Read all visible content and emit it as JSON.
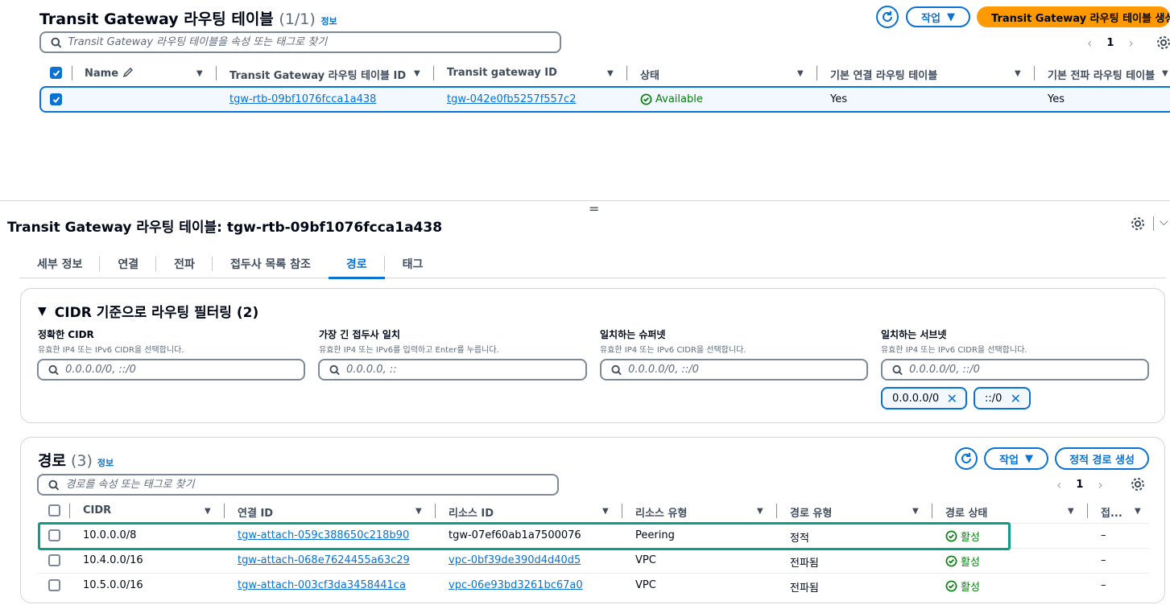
{
  "top": {
    "title": "Transit Gateway 라우팅 테이블",
    "count": "(1/1)",
    "info": "정보",
    "actions_label": "작업",
    "create_label": "Transit Gateway 라우팅 테이블 생성",
    "search_placeholder": "Transit Gateway 라우팅 테이블을 속성 또는 태그로 찾기",
    "page": "1",
    "columns": [
      "Name",
      "Transit Gateway 라우팅 테이블 ID",
      "Transit gateway ID",
      "상태",
      "기본 연결 라우팅 테이블",
      "기본 전파 라우팅 테이블"
    ],
    "row": {
      "name": "",
      "rtb_id": "tgw-rtb-09bf1076fcca1a438",
      "tgw_id": "tgw-042e0fb5257f557c2",
      "status": "Available",
      "default_assoc": "Yes",
      "default_prop": "Yes"
    }
  },
  "detail": {
    "title": "Transit Gateway 라우팅 테이블: tgw-rtb-09bf1076fcca1a438",
    "tabs": [
      "세부 정보",
      "연결",
      "전파",
      "접두사 목록 참조",
      "경로",
      "태그"
    ],
    "active_tab": "경로"
  },
  "filter": {
    "title": "CIDR 기준으로 라우팅 필터링 (2)",
    "fields": [
      {
        "label": "정확한 CIDR",
        "desc": "유효한 IP4 또는 IPv6 CIDR을 선택합니다.",
        "placeholder": "0.0.0.0/0, ::/0"
      },
      {
        "label": "가장 긴 접두사 일치",
        "desc": "유효한 IP4 또는 IPv6를 입력하고 Enter를 누릅니다.",
        "placeholder": "0.0.0.0, ::"
      },
      {
        "label": "일치하는 슈퍼넷",
        "desc": "유효한 IP4 또는 IPv6 CIDR을 선택합니다.",
        "placeholder": "0.0.0.0/0, ::/0"
      },
      {
        "label": "일치하는 서브넷",
        "desc": "유효한 IP4 또는 IPv6 CIDR을 선택합니다.",
        "placeholder": "0.0.0.0/0, ::/0"
      }
    ],
    "tokens": [
      "0.0.0.0/0",
      "::/0"
    ]
  },
  "routes": {
    "title": "경로",
    "count": "(3)",
    "info": "정보",
    "actions_label": "작업",
    "create_label": "정적 경로 생성",
    "search_placeholder": "경로를 속성 또는 태그로 찾기",
    "page": "1",
    "columns": [
      "CIDR",
      "연결 ID",
      "리소스 ID",
      "리소스 유형",
      "경로 유형",
      "경로 상태",
      "접..."
    ],
    "rows": [
      {
        "cidr": "10.0.0.0/8",
        "attachment": "tgw-attach-059c388650c218b90",
        "resource_id": "tgw-07ef60ab1a7500076",
        "resource_type": "Peering",
        "route_type": "정적",
        "state": "활성",
        "extra": "–"
      },
      {
        "cidr": "10.4.0.0/16",
        "attachment": "tgw-attach-068e7624455a63c29",
        "resource_id": "vpc-0bf39de390d4d40d5",
        "resource_type": "VPC",
        "route_type": "전파됨",
        "state": "활성",
        "extra": "–"
      },
      {
        "cidr": "10.5.0.0/16",
        "attachment": "tgw-attach-003cf3da3458441ca",
        "resource_id": "vpc-06e93bd3261bc67a0",
        "resource_type": "VPC",
        "route_type": "전파됨",
        "state": "활성",
        "extra": "–"
      }
    ]
  },
  "colors": {
    "link": "#0972d3",
    "primary": "#ff9900",
    "success": "#037f0c",
    "highlight": "#0d9e87"
  }
}
